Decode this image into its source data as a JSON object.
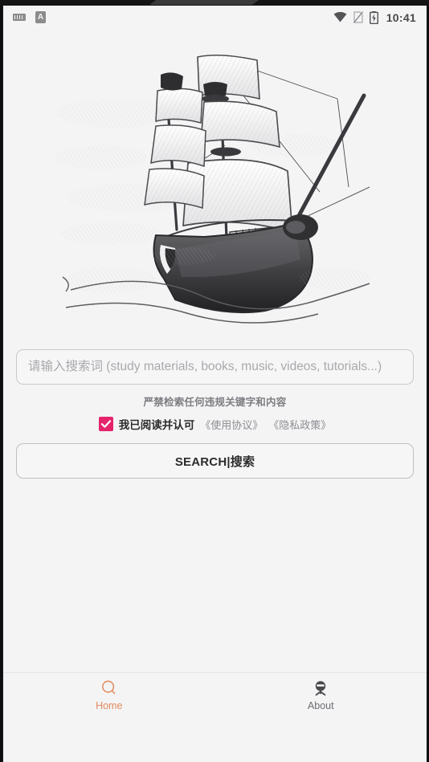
{
  "status_bar": {
    "time": "10:41",
    "left_icons": [
      {
        "name": "keyboard-icon",
        "glyph": "keyboard"
      },
      {
        "name": "input-method-a-icon",
        "label": "A"
      }
    ],
    "right_icons": [
      {
        "name": "wifi-icon"
      },
      {
        "name": "no-sim-icon"
      },
      {
        "name": "battery-charging-icon"
      }
    ]
  },
  "hero": {
    "illustration_name": "sailing-ship-pencil-sketch",
    "alt": "Pencil sketch of a tall sailing ship on waves"
  },
  "search": {
    "value": "",
    "placeholder": "请输入搜索词 (study materials, books, music, videos, tutorials...)",
    "notice": "严禁检索任何违规关键字和内容",
    "button_label": "SEARCH|搜索"
  },
  "agreement": {
    "checked": true,
    "checkbox_color": "#E5246C",
    "text": "我已阅读并认可",
    "links": [
      "《使用协议》",
      "《隐私政策》"
    ]
  },
  "bottom_nav": {
    "active_color": "#E08A5C",
    "inactive_color": "#6D6D72",
    "items": [
      {
        "label": "Home",
        "icon": "search-icon",
        "active": true
      },
      {
        "label": "About",
        "icon": "info-person-icon",
        "active": false
      }
    ]
  }
}
